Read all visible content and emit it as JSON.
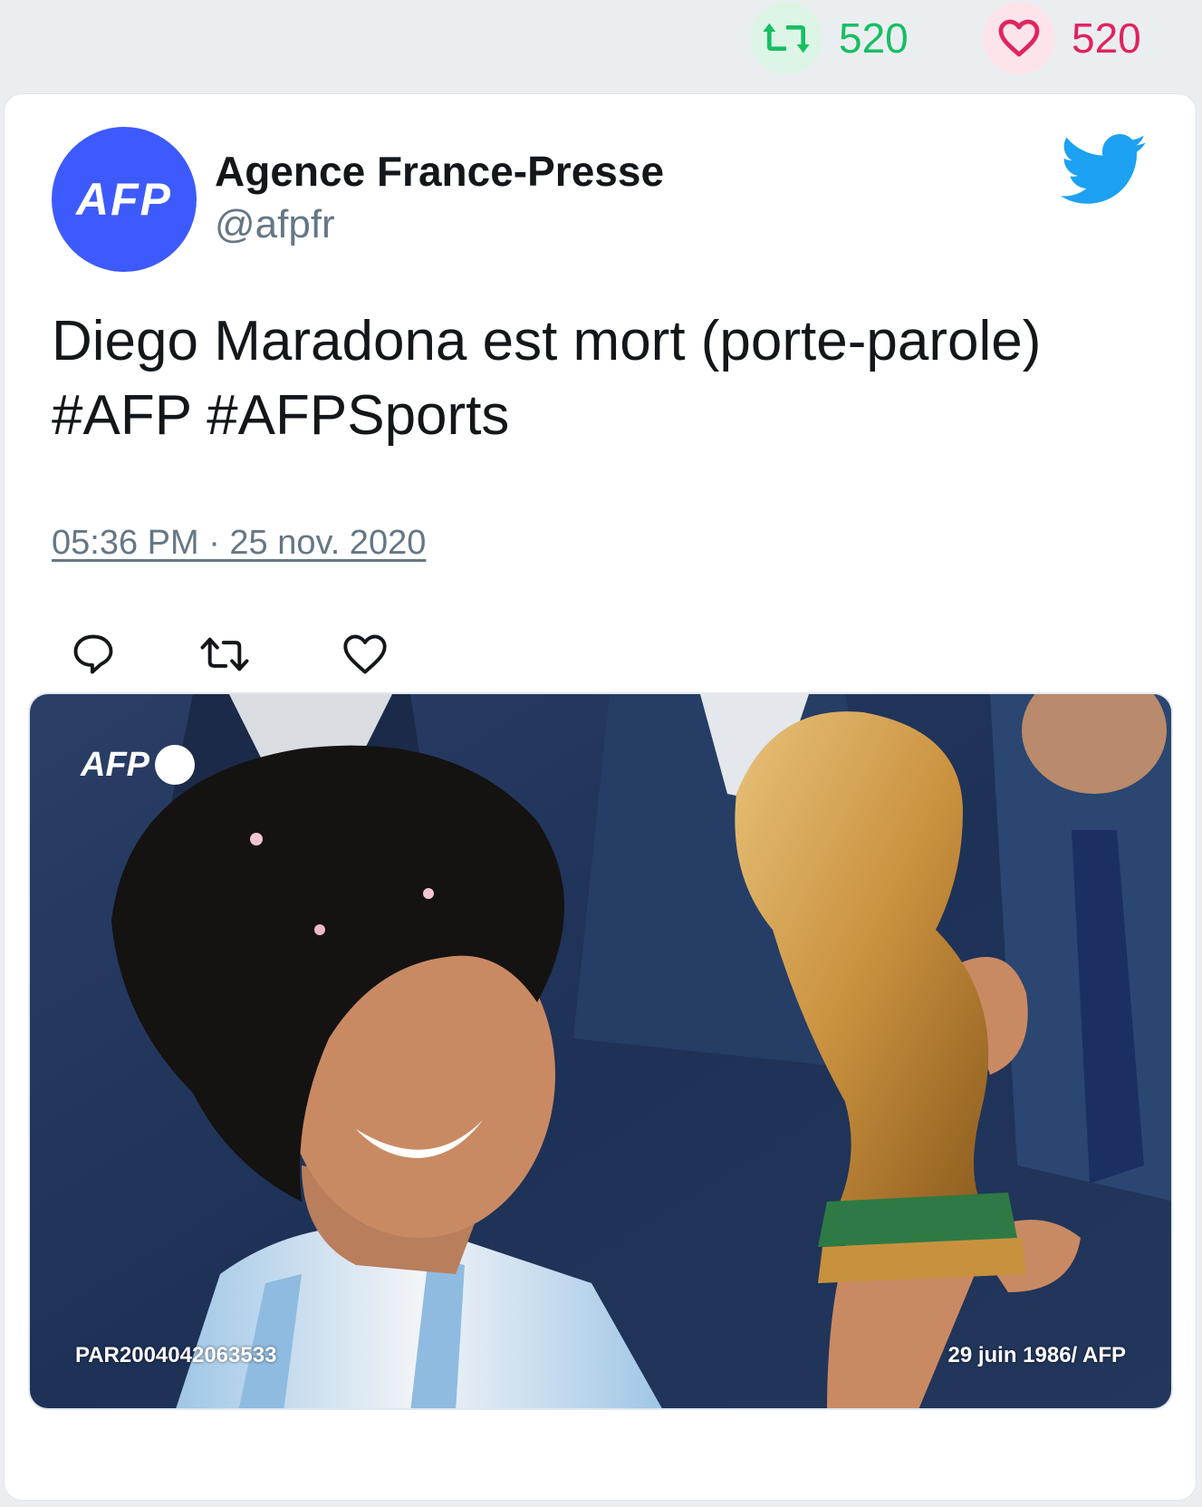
{
  "stats": {
    "retweet_count": "520",
    "like_count": "520"
  },
  "tweet": {
    "author_name": "Agence France-Presse",
    "author_handle": "@afpfr",
    "avatar_text": "AFP",
    "text_line1": "Diego Maradona est mort (porte-parole)",
    "text_line2": "#AFP #AFPSports",
    "timestamp": "05:36 PM · 25 nov. 2020"
  },
  "media": {
    "watermark": "AFP",
    "caption_left": "PAR2004042063533",
    "caption_right": "29 juin 1986/ AFP"
  },
  "icons": {
    "retweet": "retweet-icon",
    "like": "heart-icon",
    "reply": "reply-icon",
    "twitter": "twitter-bird-icon"
  },
  "colors": {
    "retweet": "#17bf63",
    "like": "#e0245e",
    "avatar_bg": "#3d5afe",
    "twitter_blue": "#1da1f2"
  }
}
